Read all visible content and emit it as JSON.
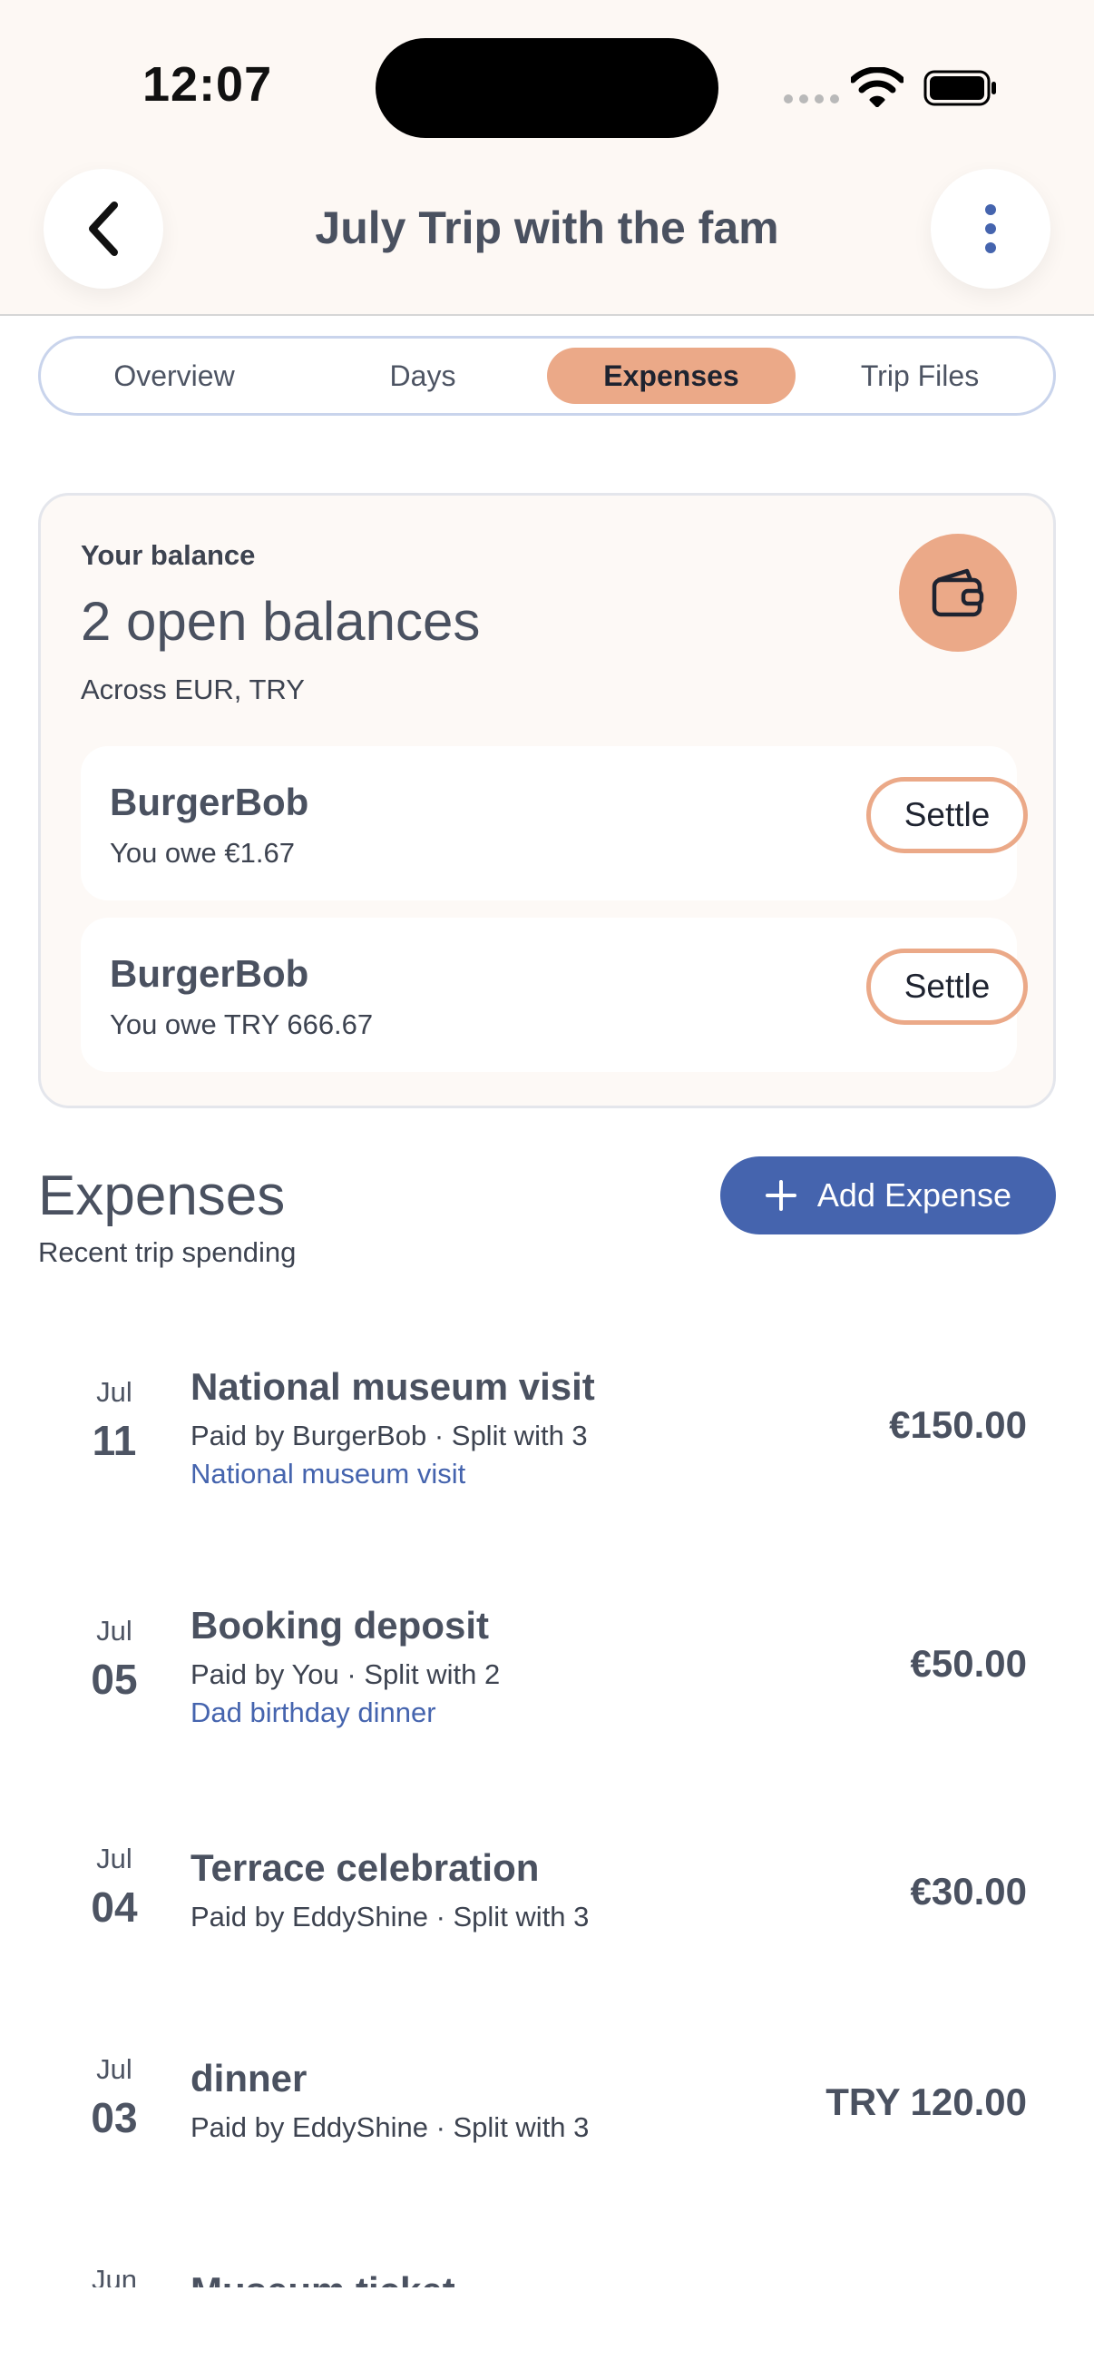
{
  "status_bar": {
    "time": "12:07"
  },
  "header": {
    "title": "July Trip with the fam"
  },
  "tabs": [
    {
      "label": "Overview",
      "active": false
    },
    {
      "label": "Days",
      "active": false
    },
    {
      "label": "Expenses",
      "active": true
    },
    {
      "label": "Trip Files",
      "active": false
    }
  ],
  "balance": {
    "label": "Your balance",
    "title": "2 open balances",
    "subtitle": "Across EUR, TRY",
    "debts": [
      {
        "name": "BurgerBob",
        "owe": "You owe €1.67",
        "action": "Settle"
      },
      {
        "name": "BurgerBob",
        "owe": "You owe TRY 666.67",
        "action": "Settle"
      }
    ]
  },
  "expenses": {
    "title": "Expenses",
    "subtitle": "Recent trip spending",
    "add_label": "Add Expense",
    "items": [
      {
        "month": "Jul",
        "day": "11",
        "name": "National museum visit",
        "paid": "Paid by BurgerBob · Split with 3",
        "link": "National museum visit",
        "amount": "€150.00"
      },
      {
        "month": "Jul",
        "day": "05",
        "name": "Booking deposit",
        "paid": "Paid by You · Split with 2",
        "link": "Dad birthday dinner",
        "amount": "€50.00"
      },
      {
        "month": "Jul",
        "day": "04",
        "name": "Terrace celebration",
        "paid": "Paid by EddyShine · Split with 3",
        "link": "",
        "amount": "€30.00"
      },
      {
        "month": "Jul",
        "day": "03",
        "name": "dinner",
        "paid": "Paid by EddyShine · Split with 3",
        "link": "",
        "amount": "TRY 120.00"
      },
      {
        "month": "Jun",
        "day": "",
        "name": "Museum ticket",
        "paid": "",
        "link": "",
        "amount": ""
      }
    ]
  },
  "colors": {
    "accent": "#eba988",
    "primary": "#4564ae",
    "header_bg": "#fdf8f4",
    "text": "#4a5160"
  },
  "icons": {
    "back": "chevron-left-icon",
    "more": "more-vertical-icon",
    "wallet": "wallet-icon",
    "add": "plus-icon"
  }
}
